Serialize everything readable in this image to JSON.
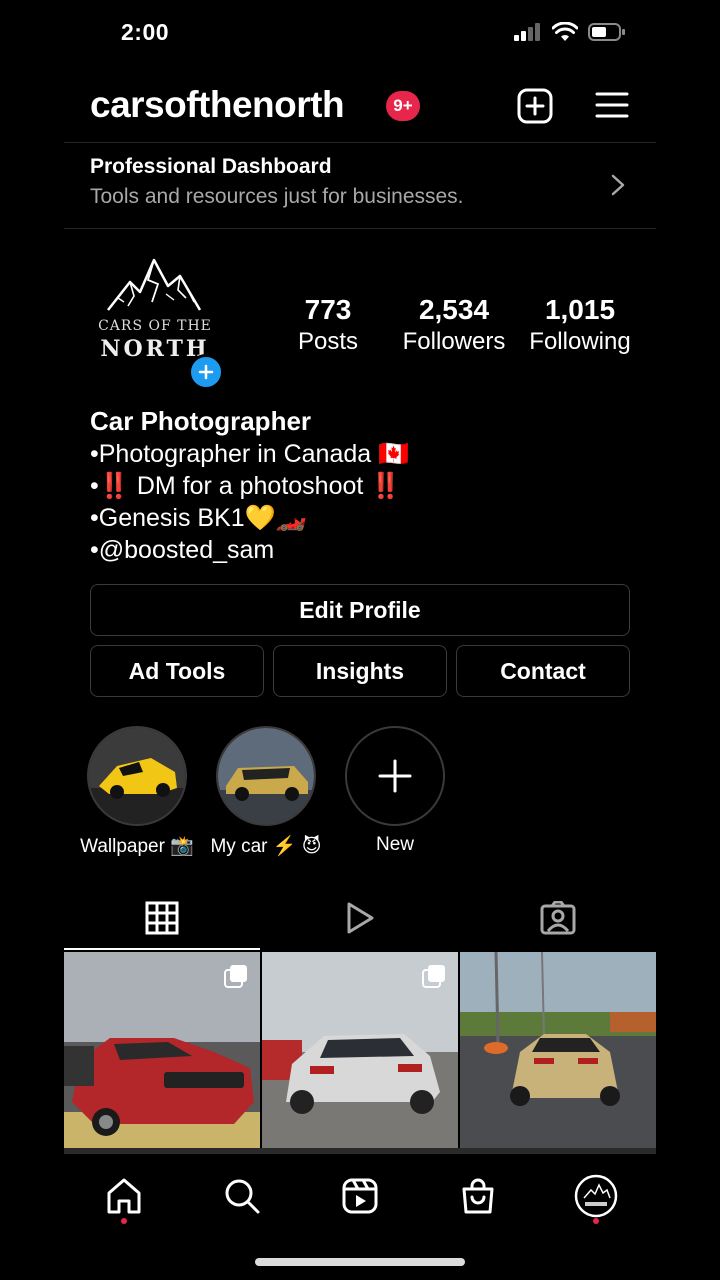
{
  "status": {
    "time": "2:00"
  },
  "header": {
    "username": "carsofthenorth",
    "notification_badge": "9+"
  },
  "dashboard": {
    "title": "Professional Dashboard",
    "subtitle": "Tools and resources just for businesses."
  },
  "profile": {
    "logo_line1": "CARS OF THE",
    "logo_line2": "NORTH",
    "stats": [
      {
        "value": "773",
        "label": "Posts"
      },
      {
        "value": "2,534",
        "label": "Followers"
      },
      {
        "value": "1,015",
        "label": "Following"
      }
    ]
  },
  "bio": {
    "name": "Car Photographer",
    "lines": [
      "•Photographer in Canada 🇨🇦",
      "•‼️ DM for a photoshoot ‼️",
      "•Genesis BK1💛🏎️",
      "•@boosted_sam"
    ]
  },
  "buttons": {
    "edit_profile": "Edit Profile",
    "ad_tools": "Ad Tools",
    "insights": "Insights",
    "contact": "Contact"
  },
  "highlights": [
    {
      "label": "Wallpaper 📸",
      "thumb": "yellow-car"
    },
    {
      "label": "My car ⚡️ 😈",
      "thumb": "gold-coupe"
    },
    {
      "label": "New",
      "thumb": "plus-icon"
    }
  ],
  "tabs": [
    "grid-icon",
    "reels-icon",
    "tagged-icon"
  ],
  "posts": [
    {
      "thumb": "red-skyline",
      "multi": true
    },
    {
      "thumb": "silver-sedan",
      "multi": true
    },
    {
      "thumb": "gold-coupe-road",
      "multi": false
    }
  ],
  "bottom_nav": [
    "home-icon",
    "search-icon",
    "reels-icon",
    "shop-icon",
    "profile-avatar"
  ],
  "colors": {
    "badge": "#e8264b",
    "accent_blue": "#1d9bf0",
    "muted_text": "#a8a8a8",
    "border": "#3a3a3a"
  }
}
